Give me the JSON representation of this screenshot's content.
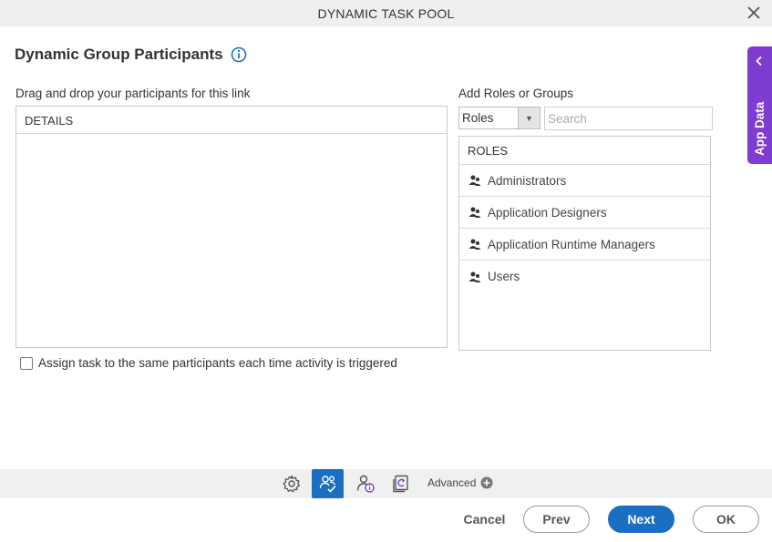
{
  "window": {
    "title": "DYNAMIC TASK POOL"
  },
  "page": {
    "heading": "Dynamic Group Participants"
  },
  "participants": {
    "label": "Drag and drop your participants for this link",
    "column_header": "DETAILS"
  },
  "add_roles": {
    "label": "Add Roles or Groups",
    "type_selected": "Roles",
    "search_placeholder": "Search",
    "list_header": "ROLES",
    "items": [
      {
        "label": "Administrators"
      },
      {
        "label": "Application Designers"
      },
      {
        "label": "Application Runtime Managers"
      },
      {
        "label": "Users"
      }
    ]
  },
  "options": {
    "same_participants_label": "Assign task to the same participants each time activity is triggered"
  },
  "side_panel": {
    "label": "App Data"
  },
  "toolbar": {
    "advanced_label": "Advanced"
  },
  "footer": {
    "cancel": "Cancel",
    "prev": "Prev",
    "next": "Next",
    "ok": "OK"
  },
  "colors": {
    "accent": "#1b6fc2",
    "side_panel": "#7e3cd1"
  },
  "icons": {
    "close": "close-icon",
    "info": "info-icon",
    "search": "search-icon",
    "role": "role-icon",
    "chevron": "chevron-left-icon",
    "gear": "gear-icon",
    "participants": "participants-icon",
    "user_info": "user-info-icon",
    "document": "document-icon",
    "plus": "plus-circle-icon"
  }
}
